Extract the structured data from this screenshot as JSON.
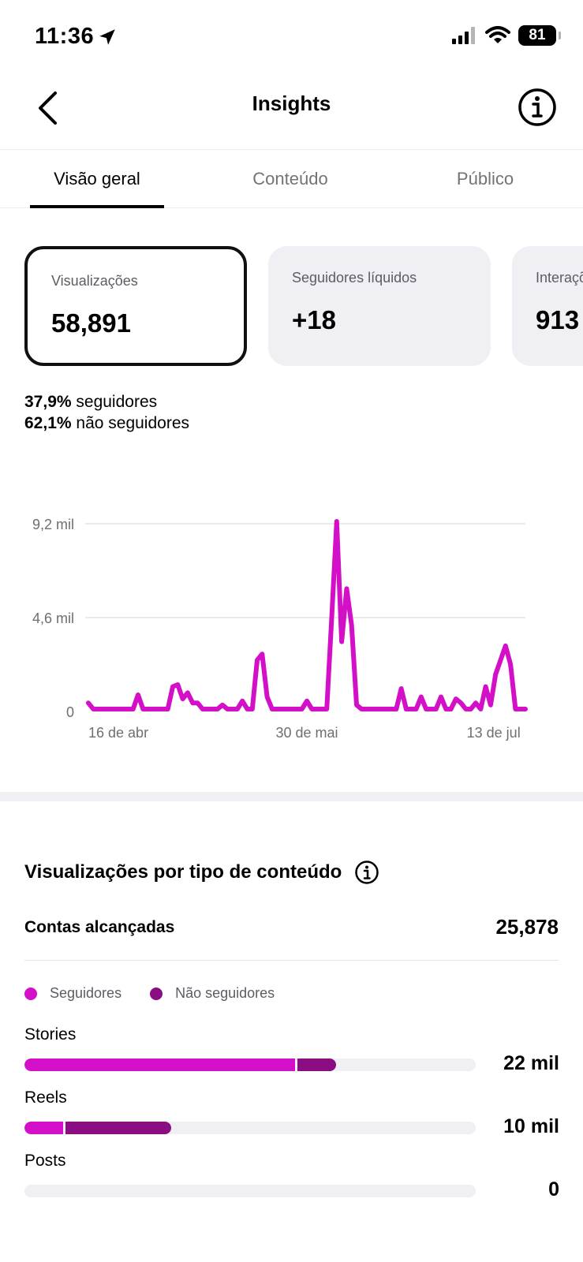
{
  "status_bar": {
    "time": "11:36",
    "battery": "81"
  },
  "header": {
    "title": "Insights"
  },
  "tabs": [
    {
      "label": "Visão geral",
      "active": true
    },
    {
      "label": "Conteúdo",
      "active": false
    },
    {
      "label": "Público",
      "active": false
    }
  ],
  "cards": [
    {
      "label": "Visualizações",
      "value": "58,891",
      "selected": true
    },
    {
      "label": "Seguidores líquidos",
      "value": "+18",
      "selected": false
    },
    {
      "label": "Interações",
      "value": "913",
      "selected": false
    }
  ],
  "split": {
    "followers_pct": "37,9%",
    "followers_label": "seguidores",
    "nonfollowers_pct": "62,1%",
    "nonfollowers_label": "não seguidores"
  },
  "chart_data": {
    "type": "line",
    "y_tick_labels": [
      "9,2 mil",
      "4,6 mil",
      "0"
    ],
    "y_ticks": [
      9200,
      4600,
      0
    ],
    "ylim": [
      0,
      9200
    ],
    "x_tick_labels": [
      "16 de abr",
      "30 de mai",
      "13 de jul"
    ],
    "x_tick_index": [
      0,
      44,
      87
    ],
    "color": "#d30fc8",
    "series": [
      {
        "values": [
          300,
          0,
          0,
          0,
          0,
          0,
          0,
          0,
          0,
          0,
          700,
          0,
          0,
          0,
          0,
          0,
          0,
          1100,
          1200,
          500,
          800,
          300,
          300,
          0,
          0,
          0,
          0,
          200,
          0,
          0,
          0,
          400,
          0,
          0,
          2400,
          2700,
          600,
          0,
          0,
          0,
          0,
          0,
          0,
          0,
          400,
          0,
          0,
          0,
          0,
          4500,
          9200,
          3300,
          5900,
          4100,
          200,
          0,
          0,
          0,
          0,
          0,
          0,
          0,
          0,
          1000,
          0,
          0,
          0,
          600,
          0,
          0,
          0,
          600,
          0,
          0,
          500,
          300,
          0,
          0,
          300,
          0,
          1100,
          200,
          1700,
          2400,
          3100,
          2200,
          0,
          0,
          0
        ]
      }
    ]
  },
  "breakdown": {
    "title": "Visualizações por tipo de conteúdo",
    "reach_label": "Contas alcançadas",
    "reach_value": "25,878",
    "legend": [
      {
        "label": "Seguidores",
        "color": "#d30fc8"
      },
      {
        "label": "Não seguidores",
        "color": "#8b0d84"
      }
    ],
    "rows": [
      {
        "label": "Stories",
        "value_text": "22 mil",
        "followers_fraction": 0.6,
        "nonfollowers_fraction": 0.085
      },
      {
        "label": "Reels",
        "value_text": "10 mil",
        "followers_fraction": 0.085,
        "nonfollowers_fraction": 0.235
      },
      {
        "label": "Posts",
        "value_text": "0",
        "followers_fraction": 0,
        "nonfollowers_fraction": 0
      }
    ]
  }
}
